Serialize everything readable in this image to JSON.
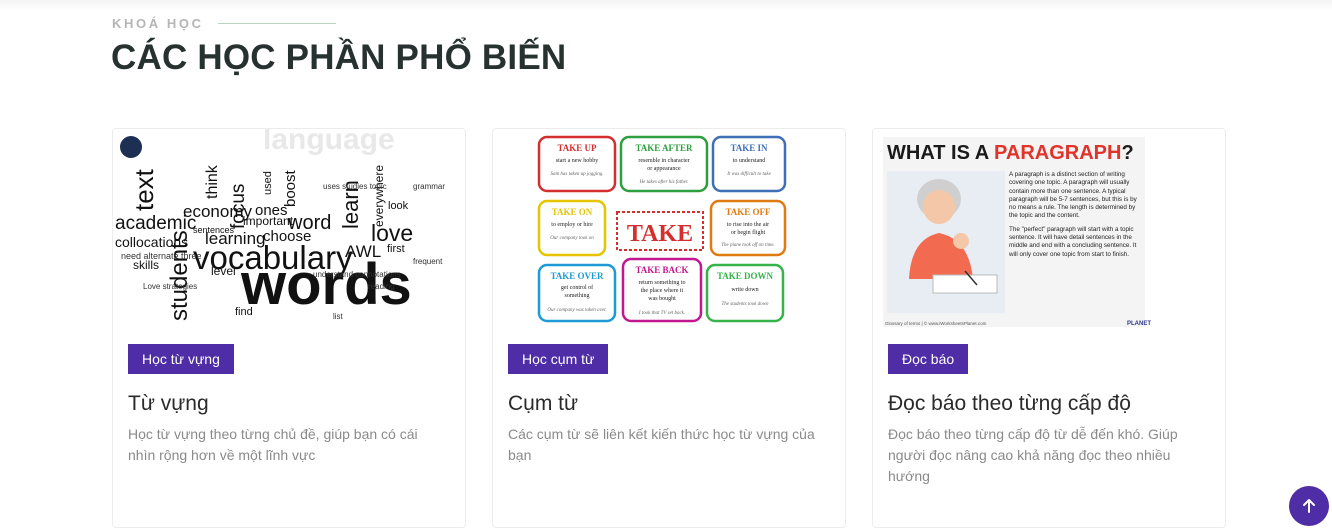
{
  "section": {
    "label": "KHOÁ HỌC",
    "title": "CÁC HỌC PHẦN PHỔ BIẾN"
  },
  "cards": [
    {
      "badge": "Học từ vựng",
      "title": "Từ vựng",
      "description": "Học từ vựng theo từng chủ đề, giúp bạn có cái nhìn rộng hơn về một lĩnh vực",
      "image": {
        "words": [
          "words",
          "vocabulary",
          "students",
          "text",
          "academic",
          "learning",
          "economy",
          "collocations",
          "love",
          "learn",
          "word",
          "think",
          "focus",
          "choose",
          "important",
          "ones",
          "AWL",
          "level",
          "skills",
          "boost",
          "everywhere",
          "find",
          "used",
          "first",
          "sentences",
          "look"
        ]
      }
    },
    {
      "badge": "Học cụm từ",
      "title": "Cụm từ",
      "description": "Các cụm từ sẽ liên kết kiến thức học từ vựng của bạn",
      "image": {
        "center": "TAKE",
        "bubbles": [
          {
            "head": "TAKE UP",
            "def": "start a new hobby",
            "color": "#d32f2f"
          },
          {
            "head": "TAKE AFTER",
            "def": "resemble in character or appearance",
            "color": "#2e9e3e"
          },
          {
            "head": "TAKE IN",
            "def": "to understand",
            "color": "#3f6fb5"
          },
          {
            "head": "TAKE ON",
            "def": "to employ or hire",
            "color": "#e6c400"
          },
          {
            "head": "TAKE OFF",
            "def": "to rise into the air or begin flight",
            "color": "#e07b12"
          },
          {
            "head": "TAKE OVER",
            "def": "get control of something",
            "color": "#1e9ad6"
          },
          {
            "head": "TAKE BACK",
            "def": "return something to the place where it was bought",
            "color": "#c2188f"
          },
          {
            "head": "TAKE DOWN",
            "def": "write down",
            "color": "#37b34a"
          }
        ]
      }
    },
    {
      "badge": "Đọc báo",
      "title": "Đọc báo theo từng cấp độ",
      "description": "Đọc báo theo từng cấp độ từ dễ đến khó. Giúp người đọc nâng cao khả năng đọc theo nhiều hướng",
      "image": {
        "heading_prefix": "WHAT IS A ",
        "heading_highlight": "PARAGRAPH",
        "heading_suffix": "?",
        "paragraph1": "A paragraph is a distinct section of writing covering one topic. A paragraph will usually contain more than one sentence. A typical paragraph will be 5-7 sentences, but this is by no means a rule. The length is determined by the topic and the content.",
        "paragraph2": "The \"perfect\" paragraph will start with a topic sentence. It will have detail sentences in the middle and end with a concluding sentence. It will only cover one topic from start to finish.",
        "footer": "Glossary of terms | © www.iWorksheetsPlanet.com",
        "logo": "PLANET"
      }
    }
  ]
}
